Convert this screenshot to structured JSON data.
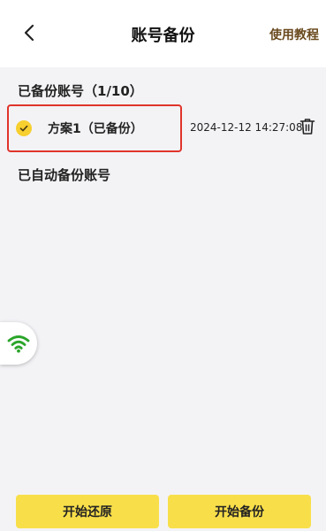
{
  "header": {
    "title": "账号备份",
    "help_label": "使用教程"
  },
  "backed_up": {
    "title": "已备份账号（1/10）",
    "items": [
      {
        "name": "方案1（已备份）",
        "time": "2024-12-12 14:27:08"
      }
    ]
  },
  "auto_backup": {
    "title": "已自动备份账号"
  },
  "footer": {
    "restore_label": "开始还原",
    "backup_label": "开始备份"
  },
  "colors": {
    "accent": "#f8df4a",
    "highlight_border": "#e0342b",
    "wifi": "#2aa52a",
    "help_link": "#6a4a1f"
  },
  "icons": {
    "back": "chevron-left-icon",
    "check": "check-circle-icon",
    "trash": "trash-icon",
    "wifi": "wifi-icon"
  }
}
